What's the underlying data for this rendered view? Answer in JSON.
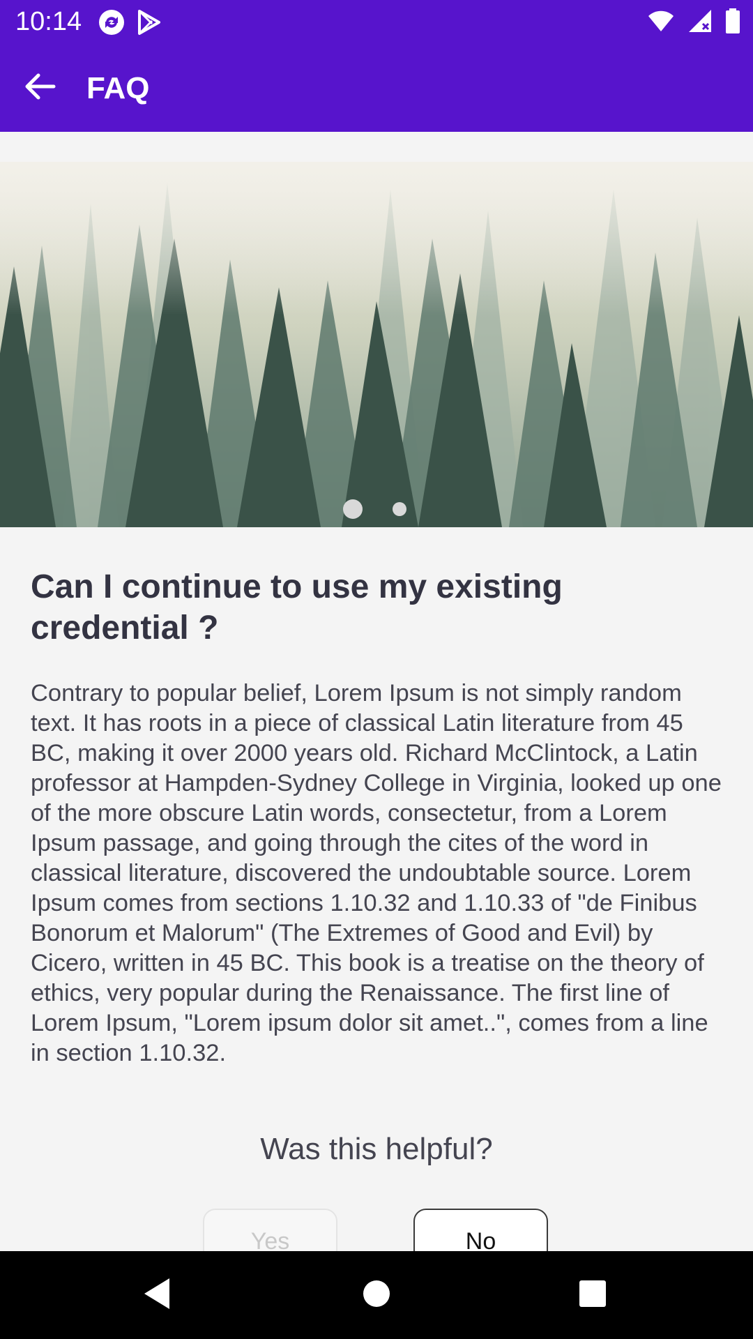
{
  "status_bar": {
    "time": "10:14",
    "icons": [
      "sync-icon",
      "play-store-icon",
      "wifi-icon",
      "signal-icon",
      "battery-icon"
    ]
  },
  "app_bar": {
    "title": "FAQ",
    "back_icon": "arrow-left-icon"
  },
  "carousel": {
    "image": "misty-forest",
    "page_count": 2,
    "active_page": 1
  },
  "faq": {
    "question": "Can I continue to use my existing credential ?",
    "answer": "Contrary to popular belief, Lorem Ipsum is not simply random text. It has roots in a piece of classical Latin literature from 45 BC, making it over 2000 years old. Richard McClintock, a Latin professor at Hampden-Sydney College in Virginia, looked up one of the more obscure Latin words, consectetur, from a Lorem Ipsum passage, and going through the cites of the word in classical literature, discovered the undoubtable source. Lorem Ipsum comes from sections 1.10.32 and 1.10.33 of \"de Finibus Bonorum et Malorum\" (The Extremes of Good and Evil) by Cicero, written in 45 BC. This book is a treatise on the theory of ethics, very popular during the Renaissance. The first line of Lorem Ipsum, \"Lorem ipsum dolor sit amet..\", comes from a line in section 1.10.32."
  },
  "feedback": {
    "prompt": "Was this helpful?",
    "yes_label": "Yes",
    "no_label": "No"
  },
  "nav_bar": {
    "icons": [
      "back-triangle-icon",
      "home-circle-icon",
      "recents-square-icon"
    ]
  },
  "colors": {
    "primary": "#5714cc",
    "background": "#f4f4f4",
    "text": "#333342"
  }
}
